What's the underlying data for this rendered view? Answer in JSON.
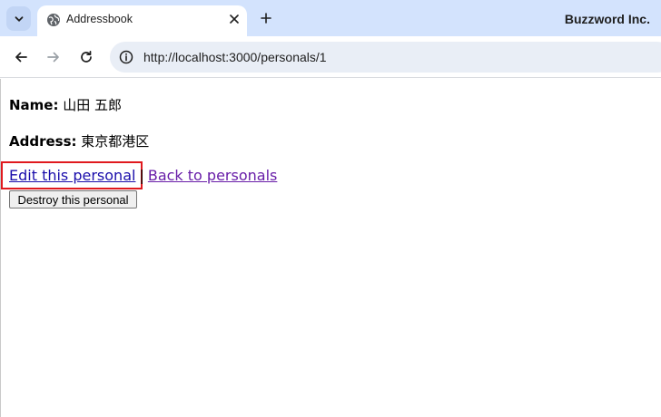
{
  "browser": {
    "tab": {
      "title": "Addressbook"
    },
    "profile_name": "Buzzword Inc.",
    "url": "http://localhost:3000/personals/1"
  },
  "page": {
    "name": {
      "label": "Name:",
      "value": "山田 五郎"
    },
    "address": {
      "label": "Address:",
      "value": "東京都港区"
    },
    "edit_link": "Edit this personal",
    "separator": "|",
    "back_link": "Back to personals",
    "destroy_button": "Destroy this personal"
  },
  "colors": {
    "tabbar_bg": "#d3e3fd",
    "omnibox_bg": "#e9eef6",
    "link": "#1a0dab",
    "visited_link": "#681da8",
    "highlight": "#e0191e"
  }
}
